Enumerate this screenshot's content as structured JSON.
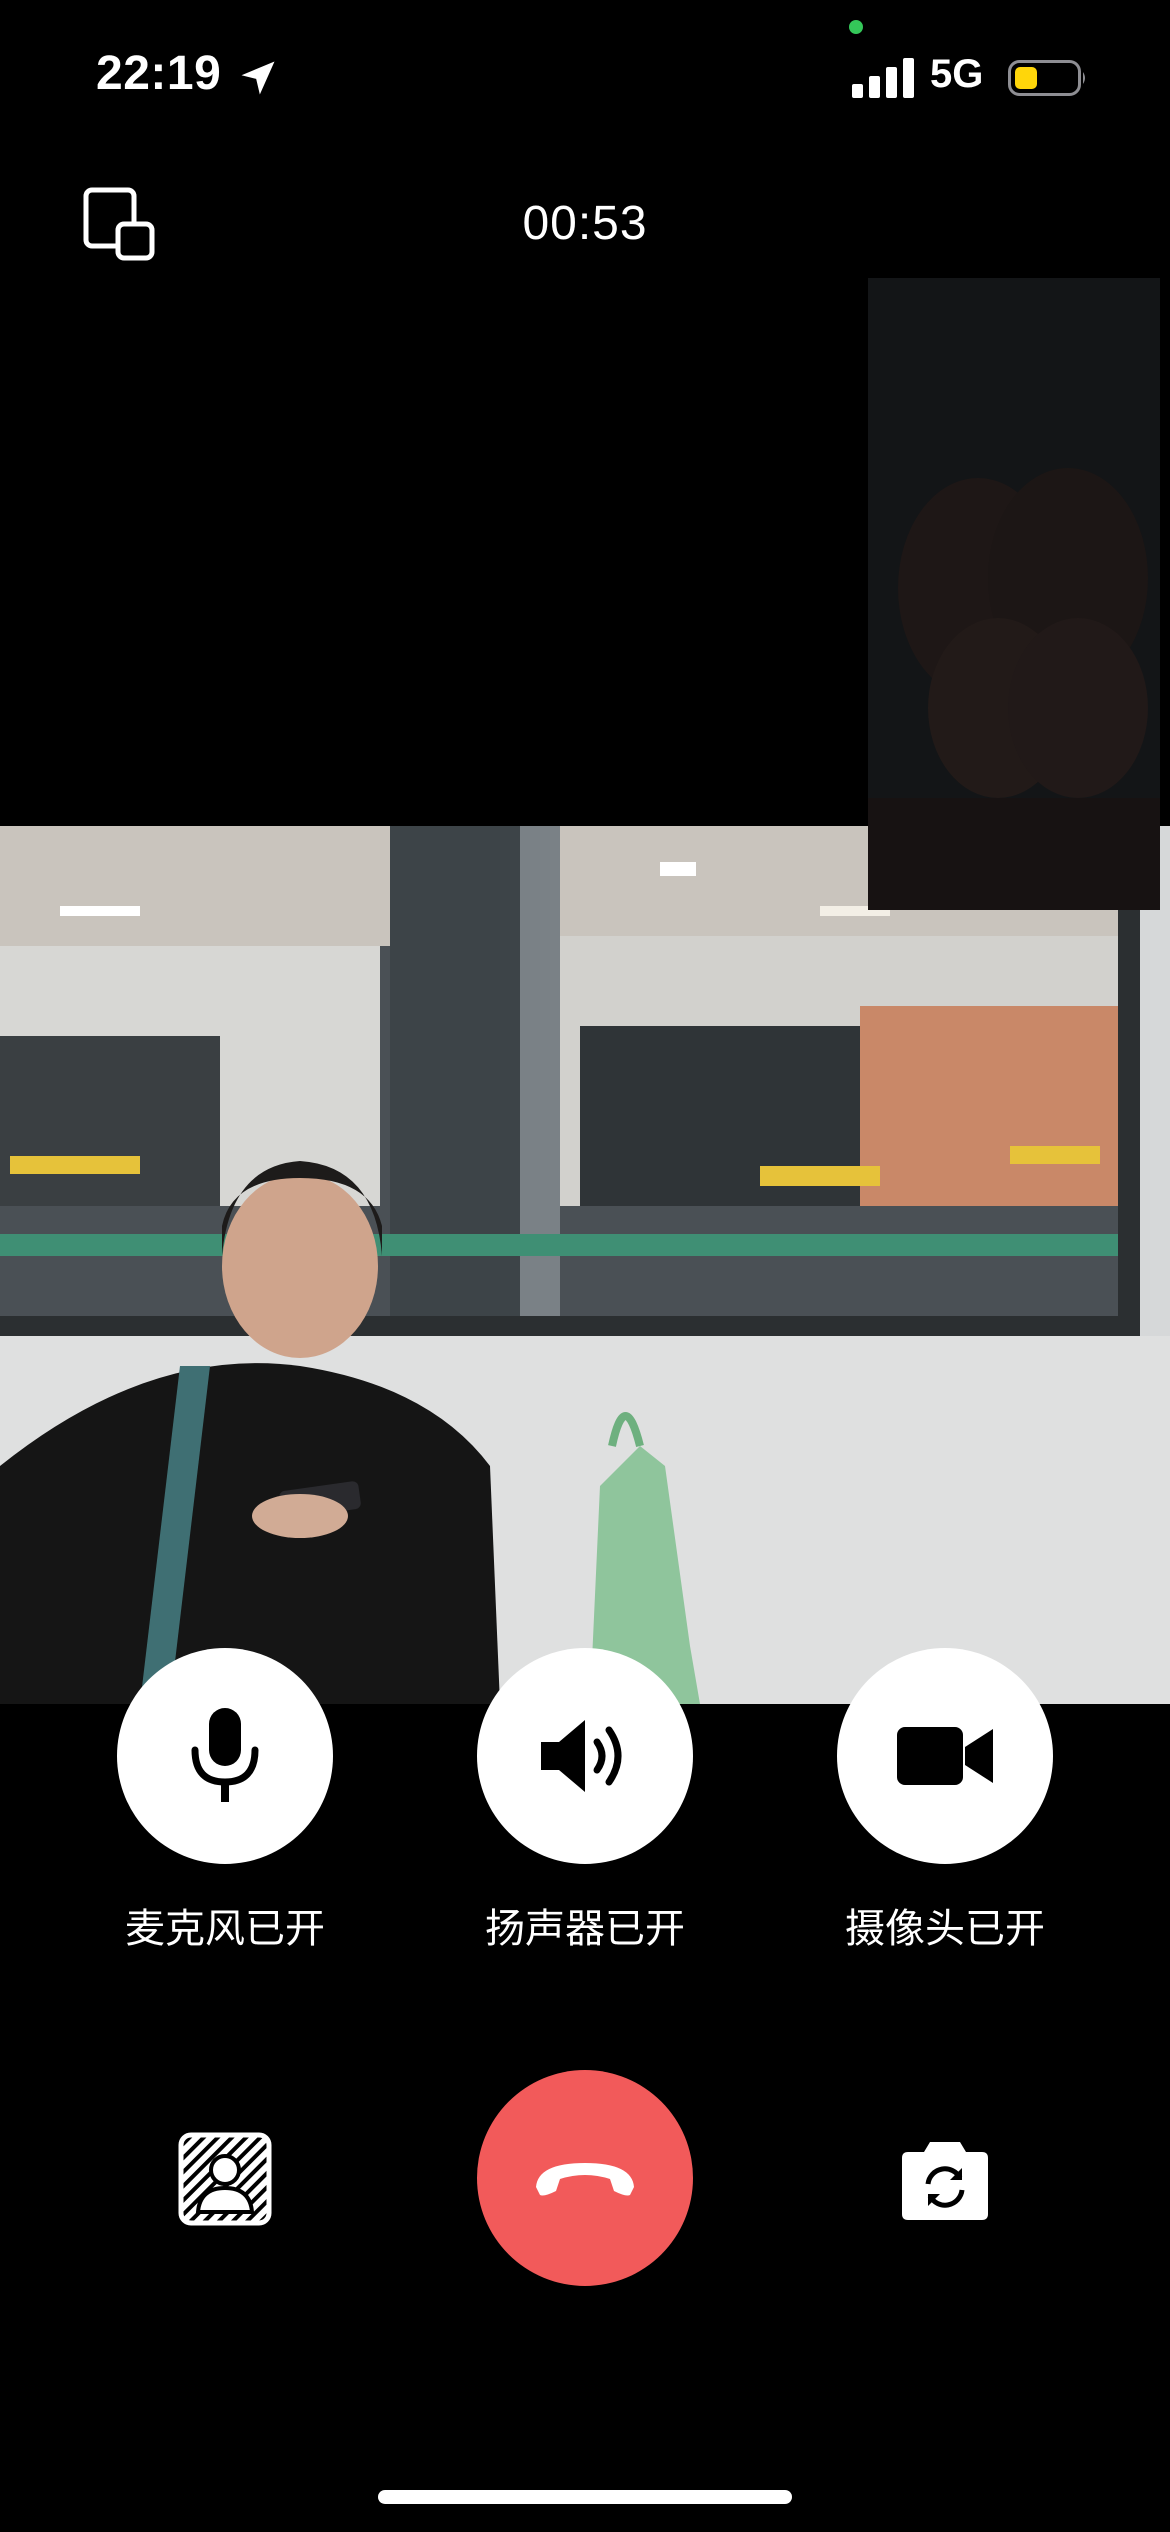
{
  "status_bar": {
    "time": "22:19",
    "network": "5G",
    "battery_color": "#ffd60a",
    "privacy_dot_color": "#34c759"
  },
  "call": {
    "timer": "00:53"
  },
  "controls": {
    "microphone": {
      "label": "麦克风已开",
      "icon": "microphone-icon"
    },
    "speaker": {
      "label": "扬声器已开",
      "icon": "speaker-icon"
    },
    "camera": {
      "label": "摄像头已开",
      "icon": "video-camera-icon"
    }
  },
  "bottom_actions": {
    "blur_background_icon": "person-blur-icon",
    "hangup_icon": "phone-hangup-icon",
    "hangup_color": "#f25a5a",
    "switch_camera_icon": "camera-switch-icon"
  }
}
